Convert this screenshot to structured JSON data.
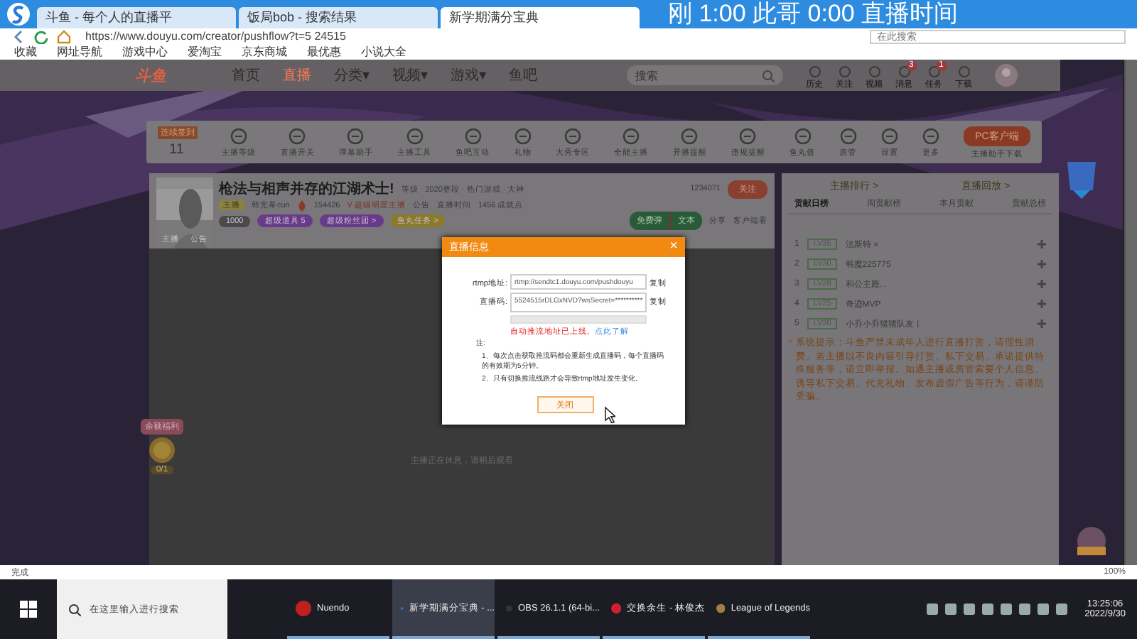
{
  "browser": {
    "tabs": [
      {
        "label": "斗鱼 - 每个人的直播平",
        "selected": false
      },
      {
        "label": "饭局bob - 搜索结果",
        "selected": false
      },
      {
        "label": "新学期满分宝典",
        "selected": true
      }
    ],
    "address": "https://www.douyu.com/creator/pushflow?t=5 24515",
    "search_placeholder": "在此搜索",
    "bookmarks": [
      "收藏",
      "网址导航",
      "游戏中心",
      "爱淘宝",
      "京东商城",
      "最优惠",
      "小说大全"
    ]
  },
  "stream_overlay": {
    "text": "刚 1:00  此哥 0:00  直播时间"
  },
  "site_nav": {
    "logo": "斗鱼",
    "items": [
      {
        "label": "首页",
        "selected": false
      },
      {
        "label": "直播",
        "selected": true
      },
      {
        "label": "分类▾",
        "selected": false
      },
      {
        "label": "视频▾",
        "selected": false
      },
      {
        "label": "游戏▾",
        "selected": false
      },
      {
        "label": "鱼吧",
        "selected": false
      }
    ],
    "search_placeholder": "搜索",
    "icons": [
      {
        "label": "历史"
      },
      {
        "label": "关注"
      },
      {
        "label": "视频"
      },
      {
        "label": "消息",
        "badge": "3"
      },
      {
        "label": "任务",
        "badge": "1"
      },
      {
        "label": "下载"
      }
    ]
  },
  "toolbar": {
    "streak_badge": "连续签到",
    "streak_count": "11",
    "items": [
      "主播等级",
      "直播开关",
      "弹幕助手",
      "主播工具",
      "鱼吧互动",
      "礼物",
      "大秀专区",
      "全能主播",
      "开播提醒",
      "违规提醒",
      "鱼丸值",
      "房管",
      "设置",
      "更多"
    ],
    "client_button": "PC客户端",
    "client_note": "主播助手下载"
  },
  "room": {
    "title": "枪法与相声并存的江湖术士!",
    "meta": "等级 · 2020赛段 · 热门游戏 · 大神",
    "viewers": "1234071",
    "follow_button": "关注",
    "level_tag": "主播",
    "streamer": "韩宪希cun",
    "hot": "154426",
    "verified": "V 超级明星主播",
    "notice": "公告",
    "schedule": "直播时间",
    "history": "1456 成就点",
    "avatar_labels": [
      "主播",
      "公告"
    ],
    "tags": [
      {
        "label": "1000",
        "color": "#4a4a4a"
      },
      {
        "label": "超级道具 5",
        "color": "#6a3a8a"
      },
      {
        "label": "超级粉丝团 >",
        "color": "#6a3a8a"
      },
      {
        "label": "鱼丸任务 >",
        "color": "#8a7a2a"
      }
    ],
    "danmu_buttons": [
      "免费弹",
      "文本"
    ],
    "share": "分享",
    "client_watch": "客户端看"
  },
  "video": {
    "message": "主播正在休息，请稍后观看",
    "reward_badge": "余额福利",
    "reward_count": "0/1"
  },
  "dialog": {
    "title": "直播信息",
    "close": "×",
    "fields": [
      {
        "label": "rtmp地址:",
        "value": "rtmp://sendtc1.douyu.com/pushdouyu",
        "copy": "复制"
      },
      {
        "label": "直播码:",
        "value": "5524515rDLGxNVD?wsSecret=**********",
        "copy": "复制"
      }
    ],
    "warning": "自动推流地址已上线,",
    "link": "点此了解",
    "note_title": "注:",
    "notes": [
      "1、每次点击获取推流码都会重新生成直播码，每个直播码的有效期为5分钟。",
      "2、只有切换推流线路才会导致rtmp地址发生变化。"
    ],
    "button": "关闭"
  },
  "side_panel": {
    "links": [
      "主播排行 >",
      "直播回放 >"
    ],
    "tabs": [
      {
        "label": "贡献日榜",
        "selected": true
      },
      {
        "label": "周贡献榜",
        "selected": false
      },
      {
        "label": "本月贡献",
        "selected": false
      },
      {
        "label": "贡献总榜",
        "selected": false
      }
    ],
    "ranks": [
      {
        "rank": "1",
        "level": "LV35",
        "name": "法斯特 ×"
      },
      {
        "rank": "2",
        "level": "LV30",
        "name": "韩魔225775"
      },
      {
        "rank": "3",
        "level": "LV28",
        "name": "和公主殿..."
      },
      {
        "rank": "4",
        "level": "LV25",
        "name": "奇迹MVP"
      },
      {
        "rank": "5",
        "level": "LV30",
        "name": "小乔小乔猪猪队友丨"
      }
    ],
    "notice": "系统提示：斗鱼严禁未成年人进行直播打赏，请理性消费。若主播以不良内容引导打赏、私下交易、承诺提供特殊服务等，请立即举报。如遇主播或房管索要个人信息、诱导私下交易、代充礼物、发布虚假广告等行为，请谨防受骗。"
  },
  "status_bar": {
    "text": "完成",
    "zoom": "100%"
  },
  "taskbar": {
    "search_placeholder": "在这里输入进行搜索",
    "apps": [
      {
        "label": "Nuendo",
        "selected": false
      },
      {
        "label": "新学期满分宝典 - ...",
        "selected": true
      },
      {
        "label": "OBS 26.1.1 (64-bi...",
        "selected": false
      },
      {
        "label": "交换余生 - 林俊杰",
        "selected": false
      },
      {
        "label": "League of Legends",
        "selected": false
      }
    ],
    "time": "13:25:06",
    "date": "2022/9/30"
  }
}
